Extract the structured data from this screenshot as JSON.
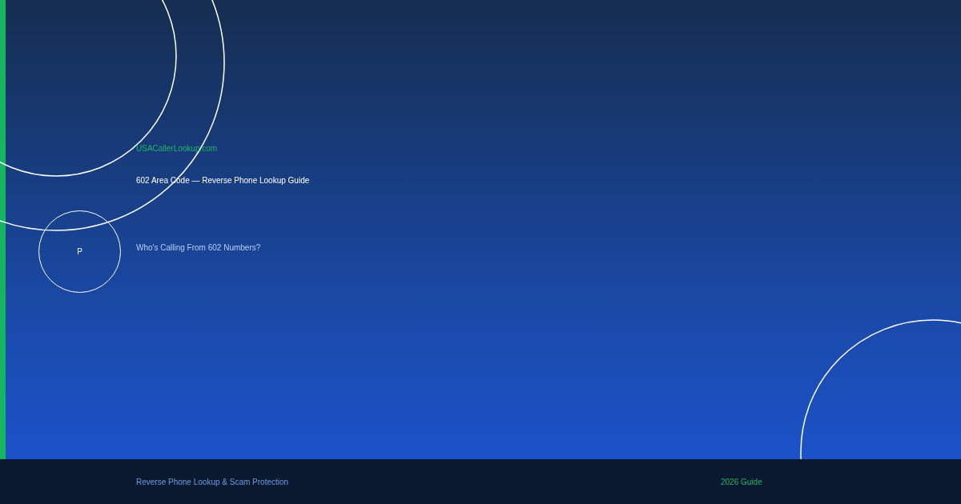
{
  "site_name": "USACallerLookup.com",
  "title": "602 Area Code — Reverse Phone Lookup Guide",
  "logo_letter": "P",
  "subtitle": "Who's Calling From 602 Numbers?",
  "footer": {
    "tagline": "Reverse Phone Lookup & Scam Protection",
    "badge": "2026 Guide"
  }
}
